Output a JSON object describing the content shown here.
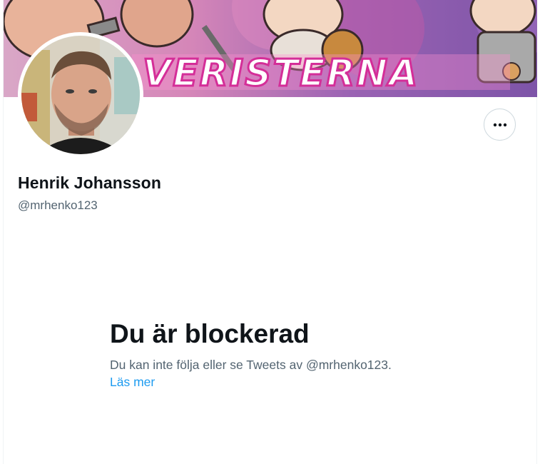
{
  "profile": {
    "display_name": "Henrik Johansson",
    "handle": "@mrhenko123",
    "banner_text": "VERISTERNA"
  },
  "actions": {
    "more_icon": "more-horizontal-icon"
  },
  "blocked": {
    "title": "Du är blockerad",
    "message": "Du kan inte följa eller se Tweets av @mrhenko123.",
    "learn_more": "Läs mer"
  },
  "colors": {
    "text_primary": "#0f1419",
    "text_secondary": "#536471",
    "link": "#1d9bf0",
    "border": "#cfd9de",
    "banner_pink": "#e94aa8",
    "banner_purple": "#8b5fb8"
  }
}
